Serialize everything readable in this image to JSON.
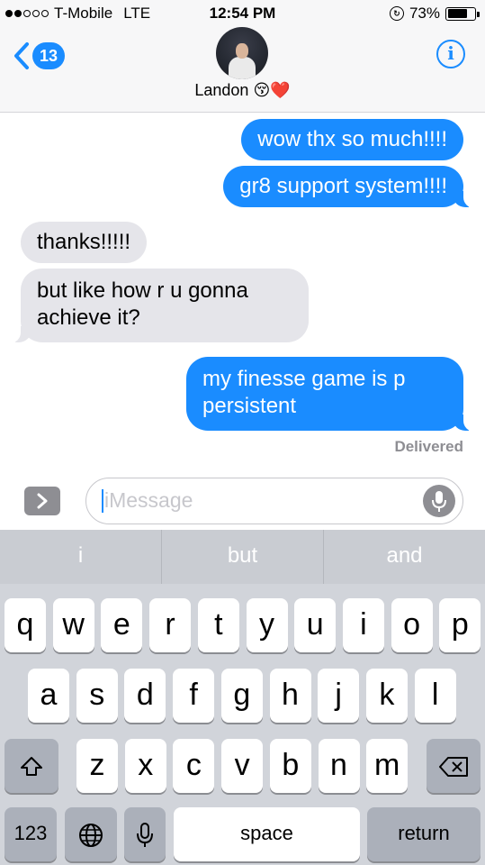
{
  "status_bar": {
    "carrier": "T-Mobile",
    "network": "LTE",
    "time": "12:54 PM",
    "battery_percent": "73%",
    "battery_level": 0.73
  },
  "header": {
    "back_count": "13",
    "contact_name": "Landon 😚❤️",
    "info_label": "i"
  },
  "messages": [
    {
      "direction": "outgoing",
      "text": "wow thx so much!!!!"
    },
    {
      "direction": "outgoing",
      "text": "gr8 support system!!!!"
    },
    {
      "direction": "incoming",
      "text": "thanks!!!!!"
    },
    {
      "direction": "incoming",
      "text": "but like how r u gonna achieve it?"
    },
    {
      "direction": "outgoing",
      "text": "my finesse game is p persistent"
    }
  ],
  "delivery_status": "Delivered",
  "compose": {
    "placeholder": "iMessage"
  },
  "keyboard": {
    "suggestions": [
      "i",
      "but",
      "and"
    ],
    "row1": [
      "q",
      "w",
      "e",
      "r",
      "t",
      "y",
      "u",
      "i",
      "o",
      "p"
    ],
    "row2": [
      "a",
      "s",
      "d",
      "f",
      "g",
      "h",
      "j",
      "k",
      "l"
    ],
    "row3": [
      "z",
      "x",
      "c",
      "v",
      "b",
      "n",
      "m"
    ],
    "numbers_label": "123",
    "space_label": "space",
    "return_label": "return"
  },
  "colors": {
    "outgoing_bubble": "#1a8cff",
    "incoming_bubble": "#e5e5ea",
    "accent": "#1a8cff"
  }
}
